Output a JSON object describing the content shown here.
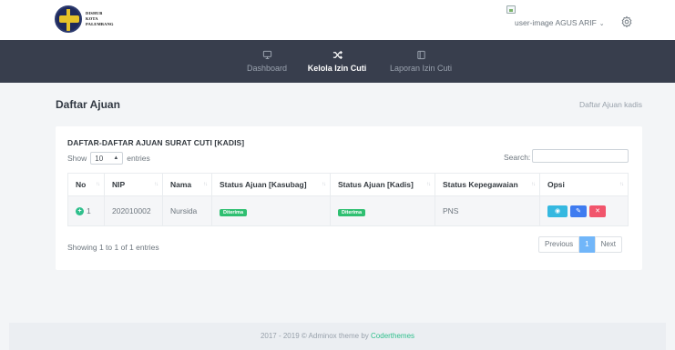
{
  "logo": {
    "lines": [
      "DISHUB",
      "KOTA",
      "PALEMBANG"
    ]
  },
  "header": {
    "user_image_alt": "user-image",
    "user_name": "AGUS ARIF",
    "chevron_icon": "chevron-down-icon",
    "settings_icon": "gear-icon"
  },
  "nav": {
    "items": [
      {
        "label": "Dashboard",
        "icon": "monitor-icon",
        "active": false
      },
      {
        "label": "Kelola Izin Cuti",
        "icon": "shuffle-icon",
        "active": true
      },
      {
        "label": "Laporan Izin Cuti",
        "icon": "document-icon",
        "active": false
      }
    ]
  },
  "page": {
    "title": "Daftar Ajuan",
    "breadcrumb": "Daftar Ajuan kadis"
  },
  "card": {
    "title": "DAFTAR-DAFTAR AJUAN SURAT CUTI [KADIS]",
    "show_label": "Show",
    "entries_value": "10",
    "entries_label": "entries",
    "search_label": "Search:",
    "search_value": ""
  },
  "table": {
    "columns": [
      "No",
      "NIP",
      "Nama",
      "Status Ajuan [Kasubag]",
      "Status Ajuan [Kadis]",
      "Status Kepegawaian",
      "Opsi"
    ],
    "rows": [
      {
        "no": "1",
        "nip": "202010002",
        "nama": "Nursida",
        "status_kasubag": "Diterima",
        "status_kadis": "Diterima",
        "kepegawaian": "PNS"
      }
    ]
  },
  "pagination": {
    "info": "Showing 1 to 1 of 1 entries",
    "previous": "Previous",
    "current": "1",
    "next": "Next"
  },
  "footer": {
    "text": "2017 - 2019 © Adminox theme by ",
    "brand": "Coderthemes"
  },
  "colors": {
    "navbar": "#383e4d",
    "success": "#2fbf71",
    "info": "#35b8e0",
    "primary": "#3f7cf0",
    "danger": "#f1556c",
    "page_active": "#71b6f9"
  }
}
